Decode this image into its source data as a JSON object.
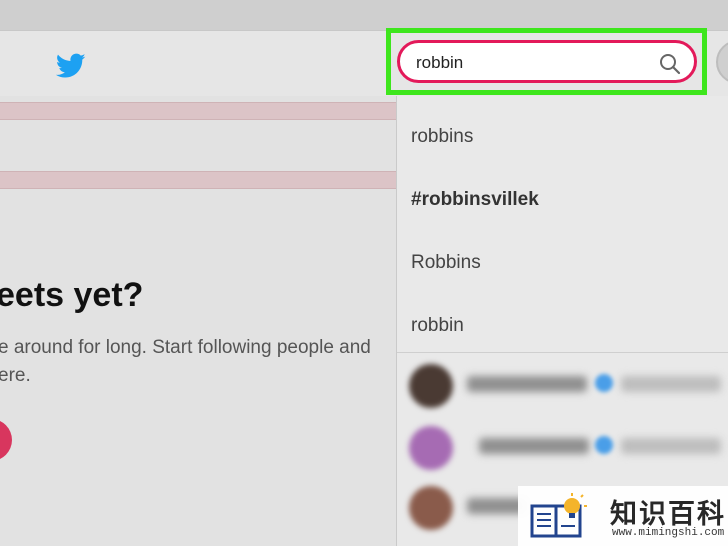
{
  "header": {
    "logo_icon": "twitter-bird-icon"
  },
  "search": {
    "value": "robbin",
    "icon": "search-icon",
    "highlight_color": "#3ee61d",
    "border_color": "#e3195a"
  },
  "suggestions": [
    {
      "text": "robbins"
    },
    {
      "text": "#robbinsvillek"
    },
    {
      "text": "Robbins"
    },
    {
      "text": "robbin"
    }
  ],
  "main": {
    "heading": "eets yet?",
    "description_line1": "e around for long. Start following people and",
    "description_line2": "ere."
  },
  "watermark": {
    "title": "知识百科",
    "url": "www.mimingshi.com"
  }
}
